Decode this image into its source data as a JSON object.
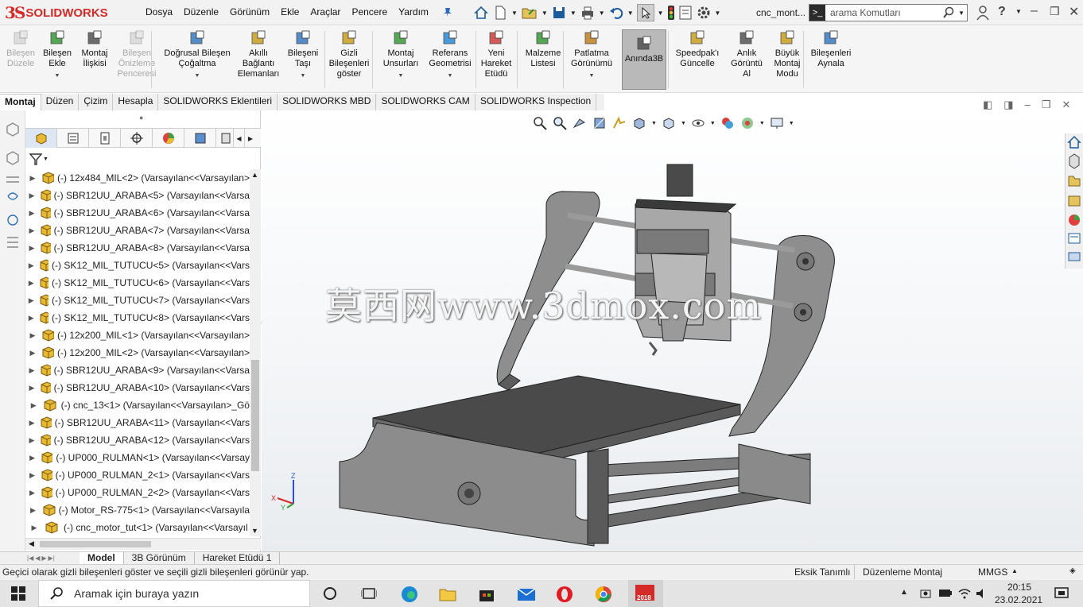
{
  "app": {
    "logo_ds": "3S",
    "logo_text": "SOLIDWORKS",
    "doc_title": "cnc_mont..."
  },
  "menu": [
    "Dosya",
    "Düzenle",
    "Görünüm",
    "Ekle",
    "Araçlar",
    "Pencere",
    "Yardım"
  ],
  "search": {
    "placeholder": "arama Komutları"
  },
  "commands": [
    {
      "label": "Bileşen\nDüzele",
      "disabled": true
    },
    {
      "label": "Bileşen\nEkle",
      "disabled": false
    },
    {
      "label": "Montaj\nİlişkisi",
      "disabled": false
    },
    {
      "label": "Bileşen\nÖnizleme\nPenceresi",
      "disabled": true
    },
    {
      "label": "Doğrusal Bileşen\nÇoğaltma",
      "disabled": false
    },
    {
      "label": "Akıllı\nBağlantı\nElemanları",
      "disabled": false
    },
    {
      "label": "Bileşeni\nTaşı",
      "disabled": false
    },
    {
      "label": "Gizli\nBileşenleri\ngöster",
      "disabled": false
    },
    {
      "label": "Montaj\nUnsurları",
      "disabled": false
    },
    {
      "label": "Referans\nGeometrisi",
      "disabled": false
    },
    {
      "label": "Yeni\nHareket\nEtüdü",
      "disabled": false
    },
    {
      "label": "Malzeme\nListesi",
      "disabled": false
    },
    {
      "label": "Patlatma\nGörünümü",
      "disabled": false
    },
    {
      "label": "Anında3B",
      "disabled": false,
      "active": true
    },
    {
      "label": "Speedpak'ı\nGüncelle",
      "disabled": false
    },
    {
      "label": "Anlık\nGörüntü\nAl",
      "disabled": false
    },
    {
      "label": "Büyük\nMontaj\nModu",
      "disabled": false
    },
    {
      "label": "Bileşenleri\nAynala",
      "disabled": false
    }
  ],
  "cmd_tabs": [
    "Montaj",
    "Düzen",
    "Çizim",
    "Hesapla",
    "SOLIDWORKS Eklentileri",
    "SOLIDWORKS MBD",
    "SOLIDWORKS CAM",
    "SOLIDWORKS Inspection"
  ],
  "tree_items": [
    "(-) 12x484_MIL<2> (Varsayılan<<Varsayılan>",
    "(-) SBR12UU_ARABA<5> (Varsayılan<<Varsa",
    "(-) SBR12UU_ARABA<6> (Varsayılan<<Varsa",
    "(-) SBR12UU_ARABA<7> (Varsayılan<<Varsa",
    "(-) SBR12UU_ARABA<8> (Varsayılan<<Varsa",
    "(-) SK12_MIL_TUTUCU<5> (Varsayılan<<Vars",
    "(-) SK12_MIL_TUTUCU<6> (Varsayılan<<Vars",
    "(-) SK12_MIL_TUTUCU<7> (Varsayılan<<Vars",
    "(-) SK12_MIL_TUTUCU<8> (Varsayılan<<Vars",
    "(-) 12x200_MIL<1> (Varsayılan<<Varsayılan>",
    "(-) 12x200_MIL<2> (Varsayılan<<Varsayılan>",
    "(-) SBR12UU_ARABA<9> (Varsayılan<<Varsa",
    "(-) SBR12UU_ARABA<10> (Varsayılan<<Vars",
    "(-) cnc_13<1> (Varsayılan<<Varsayılan>_Gö",
    "(-) SBR12UU_ARABA<11> (Varsayılan<<Vars",
    "(-) SBR12UU_ARABA<12> (Varsayılan<<Vars",
    "(-) UP000_RULMAN<1> (Varsayılan<<Varsay",
    "(-) UP000_RULMAN_2<1> (Varsayılan<<Vars",
    "(-) UP000_RULMAN_2<2> (Varsayılan<<Vars",
    "(-) Motor_RS-775<1> (Varsayılan<<Varsayıla",
    "(-) cnc_motor_tut<1> (Varsayılan<<Varsayıl"
  ],
  "watermark": "莫西网www.3dmox.com",
  "triad": {
    "z": "Z",
    "x": "X",
    "y": "Y"
  },
  "bottom_tabs": [
    "Model",
    "3B Görünüm",
    "Hareket Etüdü 1"
  ],
  "status": {
    "message": "Geçici olarak gizli bileşenleri göster ve seçili gizli bileşenleri görünür yap.",
    "definition": "Eksik Tanımlı",
    "mode": "Düzenleme Montaj",
    "units": "MMGS"
  },
  "taskbar": {
    "search": "Aramak için buraya yazın",
    "time": "20:15",
    "date": "23.02.2021",
    "sw_badge": "2018"
  },
  "colors": {
    "accent": "#d62a28",
    "model_gray": "#8a8a8a",
    "active_btn": "#b9b9b9"
  }
}
